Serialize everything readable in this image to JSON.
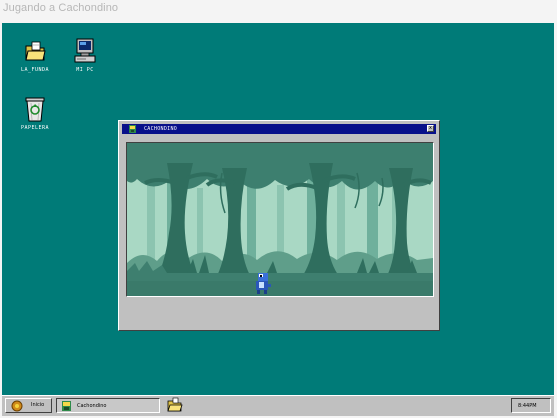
{
  "page": {
    "title": "Jugando a Cachondino"
  },
  "desktop": {
    "background": "#007b78",
    "icons": [
      {
        "label": "LA_FUNDA",
        "icon": "folder-icon"
      },
      {
        "label": "MI PC",
        "icon": "computer-icon"
      },
      {
        "label": "PAPELERA",
        "icon": "recycle-bin-icon"
      }
    ]
  },
  "window": {
    "title": "CACHONDINO",
    "close_label": "x",
    "titlebar_color": "#08108a",
    "game": {
      "scene": "forest",
      "character": "dino-sprite"
    }
  },
  "taskbar": {
    "start_label": "Inicio",
    "task_label": "Cachondino",
    "clock": "8:44PM"
  }
}
